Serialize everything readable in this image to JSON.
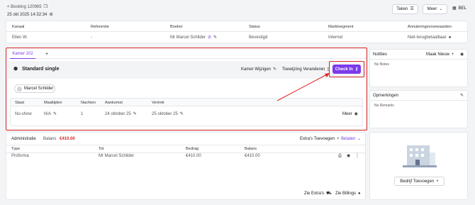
{
  "header": {
    "back_label": "< Booking 120965",
    "date": "25 okt 2025 14:32:34",
    "tasks_button": "Taken",
    "more_button": "Meer",
    "user_initials": "BEL"
  },
  "booking_table": {
    "headers": [
      "Kanaal",
      "Referentie",
      "Boeker",
      "Status",
      "Marktsegment",
      "Annuleringsvoorwaarden"
    ],
    "values": [
      "Ellen W.",
      "-",
      "Mr Marcel Schilder",
      "Bevestigd",
      "Internet",
      "Niet-terugbetaalbaar"
    ]
  },
  "room": {
    "tab_label": "Kamer 102",
    "add_tab": "+",
    "room_type": "Standard single",
    "change_room": "Kamer Wijzigen",
    "change_assignment": "Toewijzing Veranderen",
    "checkin_button": "Check In",
    "guest_name": "Marcel Schilder",
    "table_headers": [
      "Staat",
      "Maaltijden",
      "Nachten",
      "Aankomst",
      "Vertrek"
    ],
    "table_values": {
      "state": "No-show",
      "meals": "N/A",
      "nights": "1",
      "arrival": "24 oktober 25",
      "departure": "25 oktober 25"
    },
    "more_label": "Meer"
  },
  "admin": {
    "title": "Administratie",
    "balance_label": "Balans",
    "balance_value": "€410.00",
    "extras_add": "Extra's Toevoegen",
    "pay_label": "Betalen",
    "headers": [
      "Type",
      "Tot",
      "Bedrag",
      "Balans"
    ],
    "row": [
      "Proforma",
      "Mr Marcel Schilder",
      "€410.00",
      "€410.00"
    ],
    "see_extras": "Zie Extra's",
    "see_billings": "Zie Billings"
  },
  "notes": {
    "title": "Notities",
    "add_new": "Maak Nieuw",
    "empty": "No Notes"
  },
  "remarks": {
    "title": "Opmerkingen",
    "empty": "No Remarks"
  },
  "company": {
    "add_button": "Bedrijf Toevoegen"
  },
  "colors": {
    "accent": "#7c3aed",
    "highlight_red": "#dc2626",
    "balance_red": "#dc2626"
  }
}
